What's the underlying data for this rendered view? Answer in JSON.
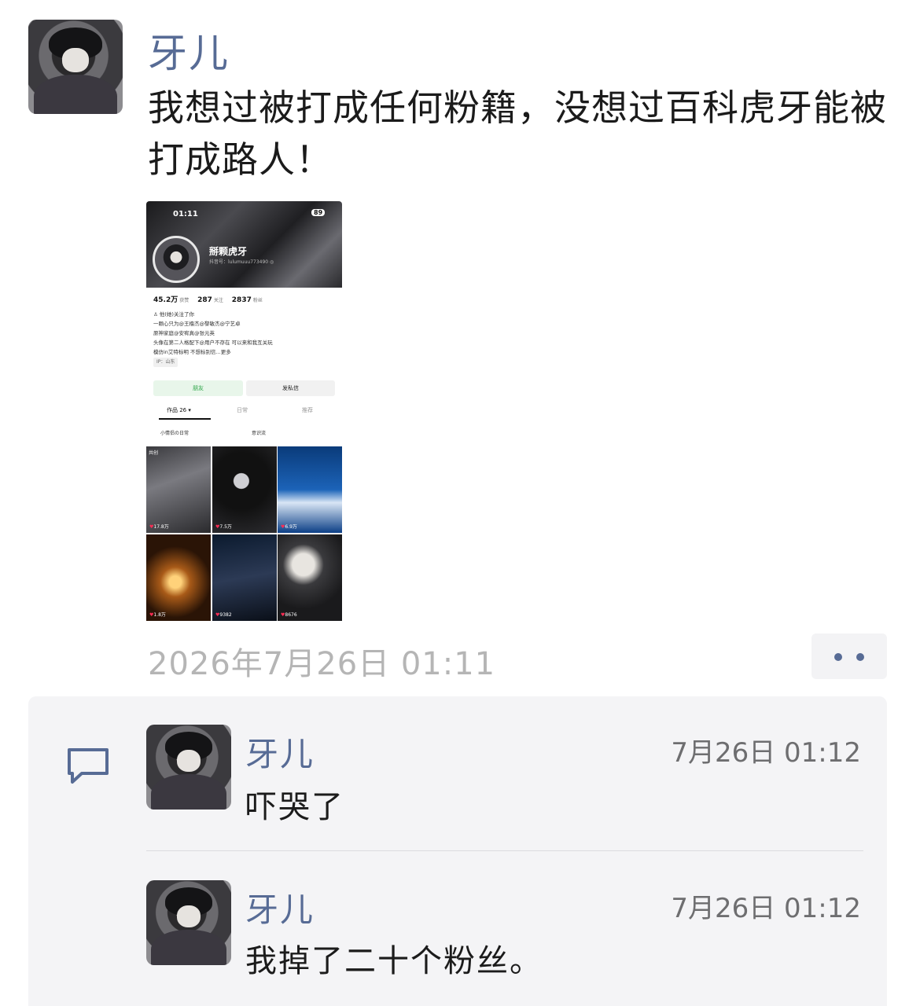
{
  "post": {
    "author": "牙儿",
    "text": "我想过被打成任何粉籍，没想过百科虎牙能被打成路人！",
    "timestamp": "2026年7月26日 01:11"
  },
  "screenshot": {
    "status_time": "01:11",
    "battery": "89",
    "nickname": "掰颗虎牙",
    "handle": "抖音号：lulumuuu773490 ◎",
    "stats": {
      "likes_value": "45.2万",
      "likes_label": "获赞",
      "following_value": "287",
      "following_label": "关注",
      "followers_value": "2837",
      "followers_label": "粉丝"
    },
    "bio_lines": [
      "♙ 他(她)关注了你",
      "一颗心只为@王橹杰@黎敏杰@宁艺卓",
      "原神家庭@安宥真@张元英",
      "头像在第二人格配下@用户不存在 可以来和我互关玩",
      "模仿in艾特标明 不想标别信...更多"
    ],
    "ip": "IP：山东",
    "friend_button": "朋友",
    "message_button": "发私信",
    "tabs": [
      "作品 26 ▾",
      "日常",
      "推荐"
    ],
    "collections": [
      "小情侣の日常",
      "意识流"
    ],
    "tile_tag": "共创",
    "tile_likes": [
      "17.8万",
      "7.5万",
      "6.9万",
      "1.8万",
      "9382",
      "8676"
    ]
  },
  "comments": [
    {
      "author": "牙儿",
      "time": "7月26日 01:12",
      "text": "吓哭了"
    },
    {
      "author": "牙儿",
      "time": "7月26日 01:12",
      "text": "我掉了二十个粉丝。"
    }
  ],
  "colors": {
    "name_blue": "#576b95",
    "timestamp_gray": "#b5b5b5",
    "comment_bg": "#f4f4f6"
  },
  "icons": {
    "comment": "speech-bubble-icon",
    "more": "more-dots-icon"
  }
}
